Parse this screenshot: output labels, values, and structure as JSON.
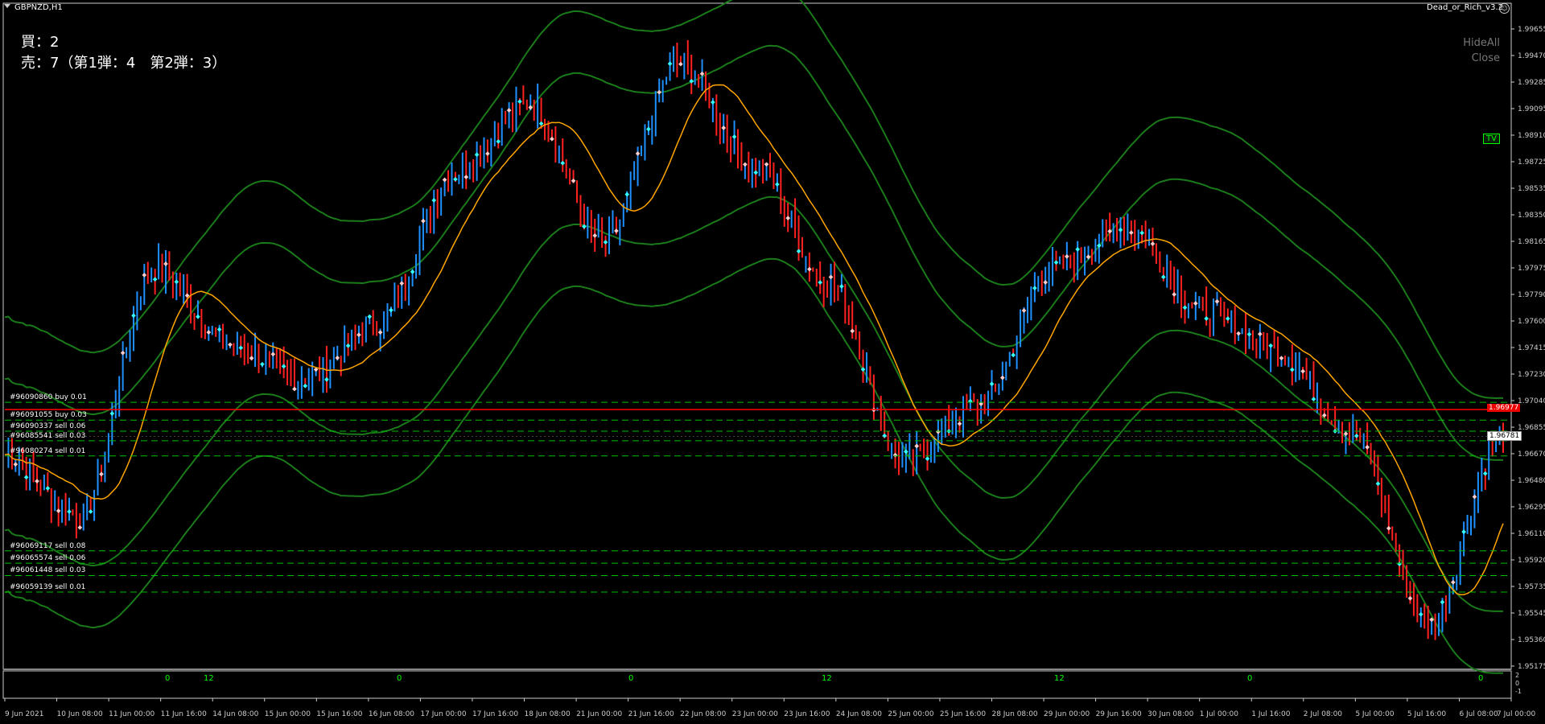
{
  "window": {
    "symbol_timeframe": "GBPNZD,H1",
    "ea_name": "Dead_or_Rich_v3.2",
    "ea_close_icon": "close-circle-icon",
    "dropdown_icon": "triangle-down-icon"
  },
  "positions_summary": {
    "buy_line": "買：2",
    "sell_line": "売：7（第1弾：4　第2弾：3）"
  },
  "buttons": {
    "hide_all": "HideAll",
    "close": "Close",
    "tv": "TV"
  },
  "orders": [
    {
      "label": "#96090860 buy 0.01",
      "price": 1.9703
    },
    {
      "label": "#96091055 buy 0.03",
      "price": 1.969
    },
    {
      "label": "#96090337 sell 0.06",
      "price": 1.9682
    },
    {
      "label": "#96085541 sell 0.03",
      "price": 1.9675
    },
    {
      "label": "#96080274 sell 0.01",
      "price": 1.9664
    },
    {
      "label": "#96069117 sell 0.08",
      "price": 1.9595
    },
    {
      "label": "#96065574 sell 0.06",
      "price": 1.9586
    },
    {
      "label": "#96061448 sell 0.03",
      "price": 1.9577
    },
    {
      "label": "#96059139 sell 0.01",
      "price": 1.9565
    }
  ],
  "price_axis": {
    "ticks": [
      "1.99655",
      "1.99470",
      "1.99285",
      "1.99095",
      "1.98910",
      "1.98725",
      "1.98535",
      "1.98350",
      "1.98165",
      "1.97975",
      "1.97790",
      "1.97600",
      "1.97415",
      "1.97230",
      "1.97040",
      "1.96855",
      "1.96670",
      "1.96480",
      "1.96295",
      "1.96110",
      "1.95920",
      "1.95735",
      "1.95545",
      "1.95360",
      "1.95175"
    ],
    "ask_tag": "1.96977",
    "bid_tag": "1.96781"
  },
  "time_axis": {
    "labels": [
      "9 Jun 2021",
      "10 Jun 08:00",
      "11 Jun 00:00",
      "11 Jun 16:00",
      "14 Jun 08:00",
      "15 Jun 00:00",
      "15 Jun 16:00",
      "16 Jun 08:00",
      "17 Jun 00:00",
      "17 Jun 16:00",
      "18 Jun 08:00",
      "21 Jun 00:00",
      "21 Jun 16:00",
      "22 Jun 08:00",
      "23 Jun 00:00",
      "23 Jun 16:00",
      "24 Jun 08:00",
      "25 Jun 00:00",
      "25 Jun 16:00",
      "28 Jun 08:00",
      "29 Jun 00:00",
      "29 Jun 16:00",
      "30 Jun 08:00",
      "1 Jul 00:00",
      "1 Jul 16:00",
      "2 Jul 08:00",
      "5 Jul 00:00",
      "5 Jul 16:00",
      "6 Jul 08:00",
      "7 Jul 00:00"
    ]
  },
  "sub_window": {
    "markers": [
      "0",
      "12",
      "0",
      "0",
      "12",
      "12",
      "0",
      "0"
    ],
    "axis_ticks": [
      "2",
      "0",
      "-1"
    ]
  },
  "colors": {
    "background": "#000000",
    "bands": "#1a7a1a",
    "ma": "#ffa500",
    "bull_candle": "#1e90ff",
    "bear_candle": "#ff2020",
    "order_line": "#00c000",
    "ask_line": "#ff0000"
  },
  "chart_data": {
    "type": "line",
    "title": "",
    "xlabel": "",
    "ylabel": "",
    "ylim": [
      1.951,
      1.9985
    ],
    "x": [
      "9 Jun",
      "10 Jun",
      "11 Jun",
      "14 Jun",
      "15 Jun",
      "16 Jun",
      "17 Jun",
      "18 Jun",
      "21 Jun",
      "22 Jun",
      "23 Jun",
      "24 Jun",
      "25 Jun",
      "28 Jun",
      "29 Jun",
      "30 Jun",
      "1 Jul",
      "2 Jul",
      "5 Jul",
      "6 Jul",
      "7 Jul"
    ],
    "series": [
      {
        "name": "",
        "values": [
          1.9665,
          1.962,
          1.98,
          1.9745,
          1.972,
          1.976,
          1.987,
          1.992,
          1.982,
          1.995,
          1.9875,
          1.979,
          1.966,
          1.97,
          1.98,
          1.983,
          1.977,
          1.974,
          1.968,
          1.954,
          1.968
        ]
      }
    ]
  }
}
